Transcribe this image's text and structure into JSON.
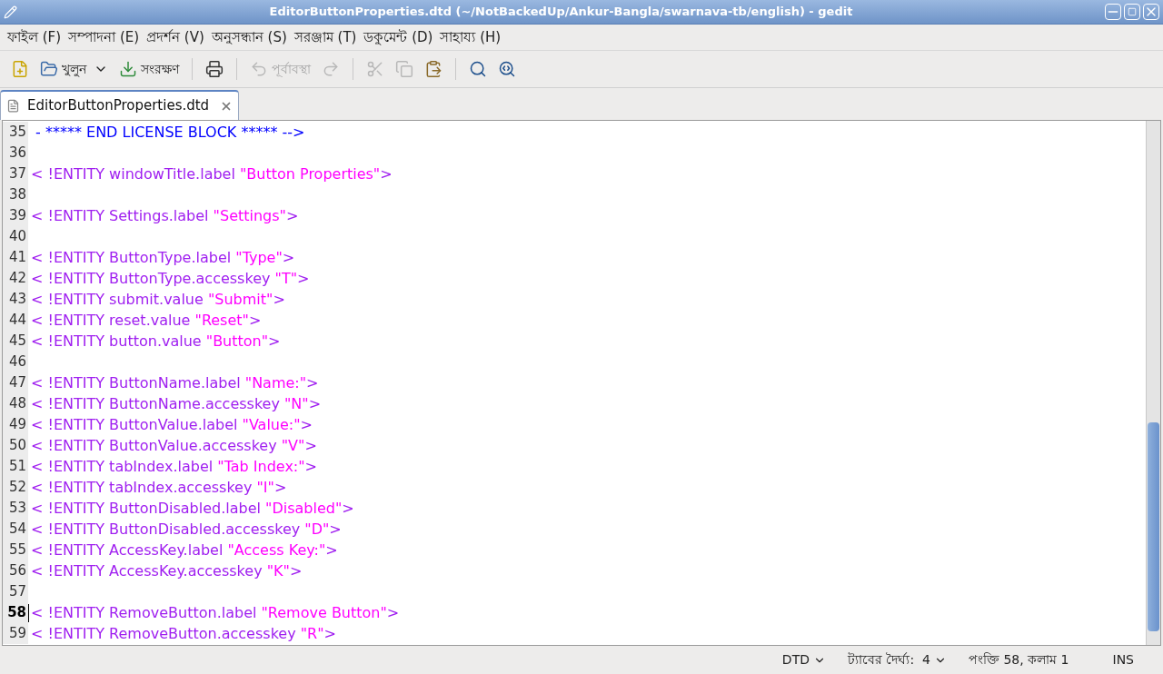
{
  "window": {
    "title": "EditorButtonProperties.dtd (~/NotBackedUp/Ankur-Bangla/swarnava-tb/english) - gedit"
  },
  "menu": [
    "ফাইল (F)",
    "সম্পাদনা (E)",
    "প্রদর্শন (V)",
    "অনুসন্ধান (S)",
    "সরঞ্জাম (T)",
    "ডকুমেন্ট (D)",
    "সাহায্য (H)"
  ],
  "toolbar": [
    {
      "kind": "new",
      "disabled": false
    },
    {
      "kind": "open",
      "label": "খুলুন",
      "disabled": false
    },
    {
      "kind": "save",
      "label": "সংরক্ষণ",
      "disabled": false
    },
    {
      "kind": "separator"
    },
    {
      "kind": "print",
      "disabled": false
    },
    {
      "kind": "separator"
    },
    {
      "kind": "undo",
      "label": "পূর্বাবস্থা",
      "disabled": true
    },
    {
      "kind": "redo",
      "disabled": true
    },
    {
      "kind": "separator"
    },
    {
      "kind": "cut",
      "disabled": true
    },
    {
      "kind": "copy",
      "disabled": true
    },
    {
      "kind": "paste",
      "disabled": false
    },
    {
      "kind": "separator"
    },
    {
      "kind": "find",
      "disabled": false
    },
    {
      "kind": "replace",
      "disabled": false
    }
  ],
  "tabs": [
    {
      "label": "EditorButtonProperties.dtd",
      "selected": true
    }
  ],
  "lines": [
    {
      "number": "35",
      "selected": false,
      "segments": [
        {
          "kind": "comment",
          "text": " - ***** END LICENSE BLOCK ***** -->"
        }
      ]
    },
    {
      "number": "36",
      "selected": false
    },
    {
      "number": "37",
      "selected": false,
      "segments": [
        {
          "kind": "keyword",
          "text": "< !ENTITY windowTitle.label "
        },
        {
          "kind": "string",
          "text": "\"Button Properties\""
        },
        {
          "kind": "keyword",
          "text": ">"
        }
      ]
    },
    {
      "number": "38",
      "selected": false
    },
    {
      "number": "39",
      "selected": false,
      "segments": [
        {
          "kind": "keyword",
          "text": "< !ENTITY Settings.label "
        },
        {
          "kind": "string",
          "text": "\"Settings\""
        },
        {
          "kind": "keyword",
          "text": ">"
        }
      ]
    },
    {
      "number": "40",
      "selected": false
    },
    {
      "number": "41",
      "selected": false,
      "segments": [
        {
          "kind": "keyword",
          "text": "< !ENTITY ButtonType.label "
        },
        {
          "kind": "string",
          "text": "\"Type\""
        },
        {
          "kind": "keyword",
          "text": ">"
        }
      ]
    },
    {
      "number": "42",
      "selected": false,
      "segments": [
        {
          "kind": "keyword",
          "text": "< !ENTITY ButtonType.accesskey "
        },
        {
          "kind": "string",
          "text": "\"T\""
        },
        {
          "kind": "keyword",
          "text": ">"
        }
      ]
    },
    {
      "number": "43",
      "selected": false,
      "segments": [
        {
          "kind": "keyword",
          "text": "< !ENTITY submit.value "
        },
        {
          "kind": "string",
          "text": "\"Submit\""
        },
        {
          "kind": "keyword",
          "text": ">"
        }
      ]
    },
    {
      "number": "44",
      "selected": false,
      "segments": [
        {
          "kind": "keyword",
          "text": "< !ENTITY reset.value "
        },
        {
          "kind": "string",
          "text": "\"Reset\""
        },
        {
          "kind": "keyword",
          "text": ">"
        }
      ]
    },
    {
      "number": "45",
      "selected": false,
      "segments": [
        {
          "kind": "keyword",
          "text": "< !ENTITY button.value "
        },
        {
          "kind": "string",
          "text": "\"Button\""
        },
        {
          "kind": "keyword",
          "text": ">"
        }
      ]
    },
    {
      "number": "46",
      "selected": false
    },
    {
      "number": "47",
      "selected": false,
      "segments": [
        {
          "kind": "keyword",
          "text": "< !ENTITY ButtonName.label "
        },
        {
          "kind": "string",
          "text": "\"Name:\""
        },
        {
          "kind": "keyword",
          "text": ">"
        }
      ]
    },
    {
      "number": "48",
      "selected": false,
      "segments": [
        {
          "kind": "keyword",
          "text": "< !ENTITY ButtonName.accesskey "
        },
        {
          "kind": "string",
          "text": "\"N\""
        },
        {
          "kind": "keyword",
          "text": ">"
        }
      ]
    },
    {
      "number": "49",
      "selected": false,
      "segments": [
        {
          "kind": "keyword",
          "text": "< !ENTITY ButtonValue.label "
        },
        {
          "kind": "string",
          "text": "\"Value:\""
        },
        {
          "kind": "keyword",
          "text": ">"
        }
      ]
    },
    {
      "number": "50",
      "selected": false,
      "segments": [
        {
          "kind": "keyword",
          "text": "< !ENTITY ButtonValue.accesskey "
        },
        {
          "kind": "string",
          "text": "\"V\""
        },
        {
          "kind": "keyword",
          "text": ">"
        }
      ]
    },
    {
      "number": "51",
      "selected": false,
      "segments": [
        {
          "kind": "keyword",
          "text": "< !ENTITY tabIndex.label "
        },
        {
          "kind": "string",
          "text": "\"Tab Index:\""
        },
        {
          "kind": "keyword",
          "text": ">"
        }
      ]
    },
    {
      "number": "52",
      "selected": false,
      "segments": [
        {
          "kind": "keyword",
          "text": "< !ENTITY tabIndex.accesskey "
        },
        {
          "kind": "string",
          "text": "\"I\""
        },
        {
          "kind": "keyword",
          "text": ">"
        }
      ]
    },
    {
      "number": "53",
      "selected": false,
      "segments": [
        {
          "kind": "keyword",
          "text": "< !ENTITY ButtonDisabled.label "
        },
        {
          "kind": "string",
          "text": "\"Disabled\""
        },
        {
          "kind": "keyword",
          "text": ">"
        }
      ]
    },
    {
      "number": "54",
      "selected": false,
      "segments": [
        {
          "kind": "keyword",
          "text": "< !ENTITY ButtonDisabled.accesskey "
        },
        {
          "kind": "string",
          "text": "\"D\""
        },
        {
          "kind": "keyword",
          "text": ">"
        }
      ]
    },
    {
      "number": "55",
      "selected": false,
      "segments": [
        {
          "kind": "keyword",
          "text": "< !ENTITY AccessKey.label "
        },
        {
          "kind": "string",
          "text": "\"Access Key:\""
        },
        {
          "kind": "keyword",
          "text": ">"
        }
      ]
    },
    {
      "number": "56",
      "selected": false,
      "segments": [
        {
          "kind": "keyword",
          "text": "< !ENTITY AccessKey.accesskey "
        },
        {
          "kind": "string",
          "text": "\"K\""
        },
        {
          "kind": "keyword",
          "text": ">"
        }
      ]
    },
    {
      "number": "57",
      "selected": false
    },
    {
      "number": "58",
      "selected": true,
      "segments": [
        {
          "kind": "keyword",
          "text": "< !ENTITY RemoveButton.label "
        },
        {
          "kind": "string",
          "text": "\"Remove Button\""
        },
        {
          "kind": "keyword",
          "text": ">"
        }
      ]
    },
    {
      "number": "59",
      "selected": false,
      "segments": [
        {
          "kind": "keyword",
          "text": "< !ENTITY RemoveButton.accesskey "
        },
        {
          "kind": "string",
          "text": "\"R\""
        },
        {
          "kind": "keyword",
          "text": ">"
        }
      ]
    }
  ],
  "status_bar": {
    "language": "DTD",
    "tab_width": "ট্যাবের দৈর্ঘ্য:  4",
    "position": "পংক্তি 58, কলাম 1",
    "mode": "INS"
  }
}
